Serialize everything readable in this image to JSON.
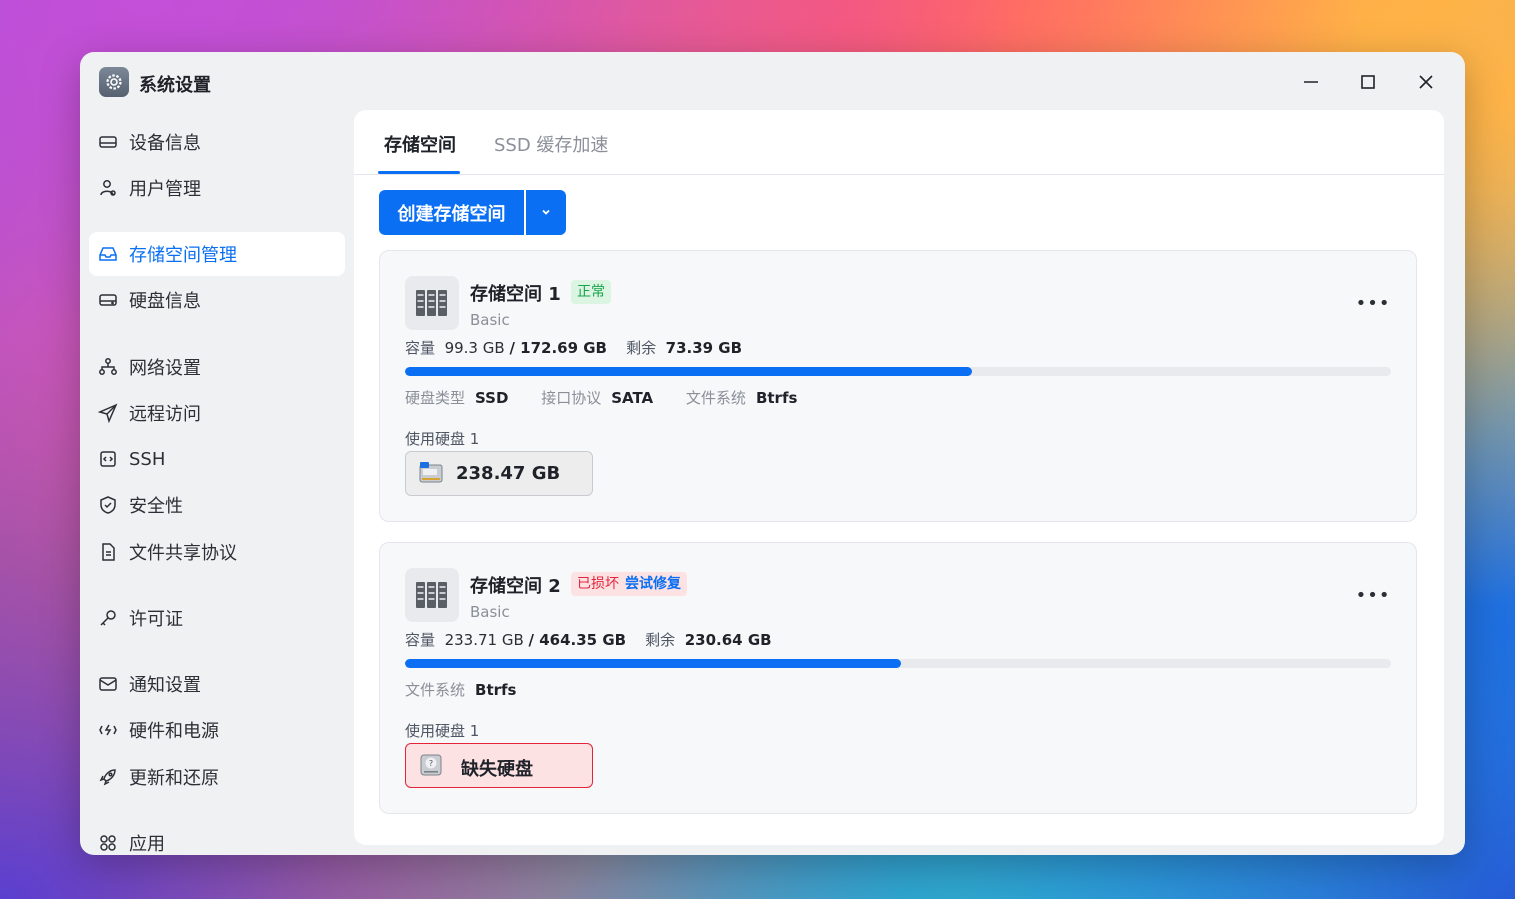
{
  "window": {
    "title": "系统设置"
  },
  "sidebar": {
    "items": [
      {
        "label": "设备信息",
        "icon": "device-icon"
      },
      {
        "label": "用户管理",
        "icon": "user-icon"
      },
      {
        "label": "存储空间管理",
        "icon": "storage-icon",
        "active": true
      },
      {
        "label": "硬盘信息",
        "icon": "disk-icon"
      },
      {
        "label": "网络设置",
        "icon": "network-icon"
      },
      {
        "label": "远程访问",
        "icon": "send-icon"
      },
      {
        "label": "SSH",
        "icon": "terminal-icon"
      },
      {
        "label": "安全性",
        "icon": "shield-icon"
      },
      {
        "label": "文件共享协议",
        "icon": "document-icon"
      },
      {
        "label": "许可证",
        "icon": "key-icon"
      },
      {
        "label": "通知设置",
        "icon": "mail-icon"
      },
      {
        "label": "硬件和电源",
        "icon": "power-icon"
      },
      {
        "label": "更新和还原",
        "icon": "rocket-icon"
      },
      {
        "label": "应用",
        "icon": "apps-icon"
      }
    ]
  },
  "tabs": [
    {
      "label": "存储空间",
      "active": true
    },
    {
      "label": "SSD 缓存加速",
      "active": false
    }
  ],
  "toolbar": {
    "create_label": "创建存储空间"
  },
  "pools": [
    {
      "name": "存储空间 1",
      "status": "正常",
      "type": "Basic",
      "capacity_label": "容量",
      "used": "99.3 GB",
      "total": "172.69 GB",
      "remaining_label": "剩余",
      "remaining": "73.39 GB",
      "usage_fraction": 0.575,
      "props": [
        {
          "k": "硬盘类型",
          "v": "SSD"
        },
        {
          "k": "接口协议",
          "v": "SATA"
        },
        {
          "k": "文件系统",
          "v": "Btrfs"
        }
      ],
      "disks_label": "使用硬盘 1",
      "disk": "238.47 GB"
    },
    {
      "name": "存储空间 2",
      "status": "已损坏",
      "repair": "尝试修复",
      "type": "Basic",
      "capacity_label": "容量",
      "used": "233.71 GB",
      "total": "464.35 GB",
      "remaining_label": "剩余",
      "remaining": "230.64 GB",
      "usage_fraction": 0.503,
      "props": [
        {
          "k": "文件系统",
          "v": "Btrfs"
        }
      ],
      "disks_label": "使用硬盘 1",
      "disk": "缺失硬盘"
    }
  ],
  "colors": {
    "accent": "#0a6ff2",
    "ok": "#16a34a",
    "danger": "#e5243b"
  }
}
